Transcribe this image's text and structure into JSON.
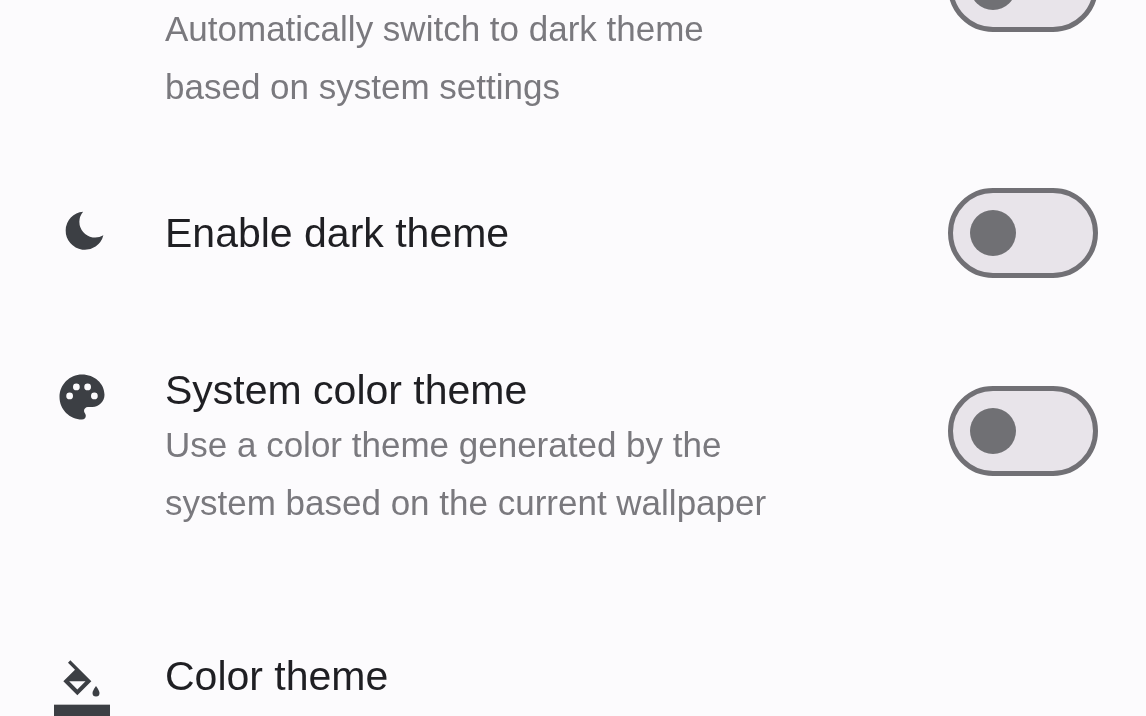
{
  "settings": [
    {
      "kind": "switch",
      "subtitle": [
        "Automatically switch to dark theme",
        "based on system settings"
      ],
      "on": false
    },
    {
      "kind": "switch",
      "title": "Enable dark theme",
      "on": false
    },
    {
      "kind": "switch",
      "title": "System color theme",
      "subtitle": [
        "Use a color theme generated by the",
        "system based on the current wallpaper"
      ],
      "on": false
    },
    {
      "kind": "option",
      "title": "Color theme"
    }
  ]
}
